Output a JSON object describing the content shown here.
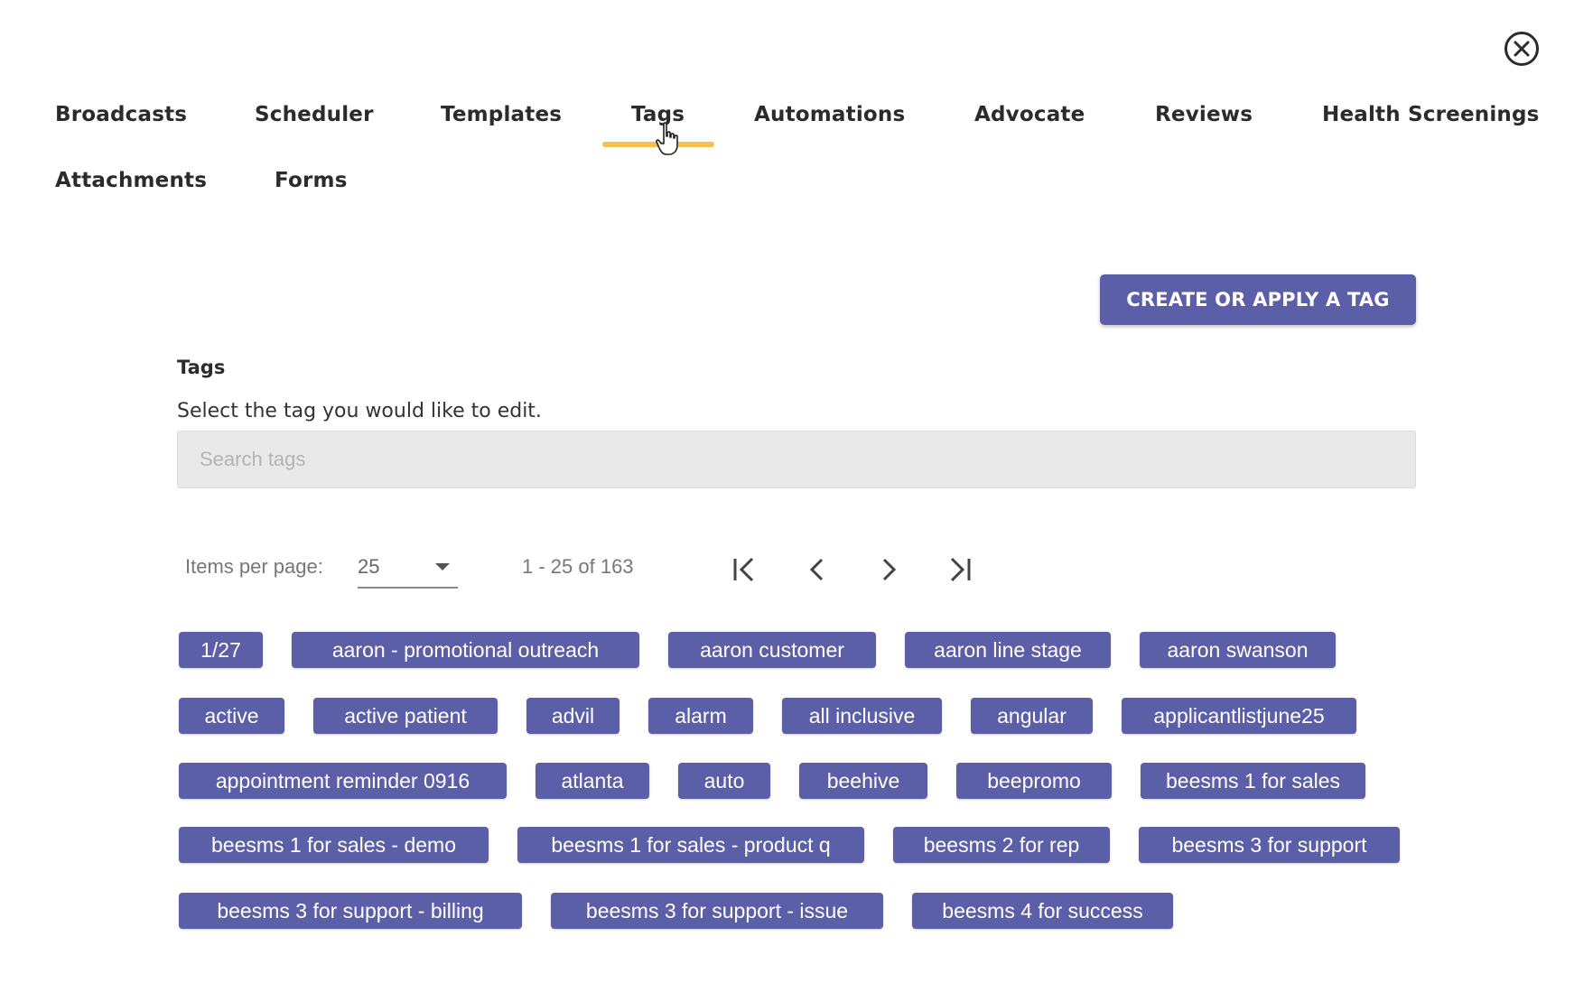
{
  "close": {
    "icon": "close-circle-icon"
  },
  "nav": {
    "tabs": [
      {
        "label": "Broadcasts"
      },
      {
        "label": "Scheduler"
      },
      {
        "label": "Templates"
      },
      {
        "label": "Tags"
      },
      {
        "label": "Automations"
      },
      {
        "label": "Advocate"
      },
      {
        "label": "Reviews"
      },
      {
        "label": "Health Screenings"
      },
      {
        "label": "Attachments"
      },
      {
        "label": "Forms"
      }
    ],
    "active_tab": "Tags",
    "underline_color": "#f2c14e"
  },
  "actions": {
    "create_label": "CREATE OR APPLY A TAG"
  },
  "tags_section": {
    "title": "Tags",
    "description": "Select the tag you would like to edit.",
    "search_placeholder": "Search tags",
    "search_value": ""
  },
  "pagination": {
    "items_per_page_label": "Items per page:",
    "items_per_page": "25",
    "range": "1 - 25 of 163",
    "first_icon": "first-page-icon",
    "prev_icon": "chevron-left-icon",
    "next_icon": "chevron-right-icon",
    "last_icon": "last-page-icon"
  },
  "tags": [
    "1/27",
    "aaron - promotional outreach",
    "aaron customer",
    "aaron line stage",
    "aaron swanson",
    "active",
    "active patient",
    "advil",
    "alarm",
    "all inclusive",
    "angular",
    "applicantlistjune25",
    "appointment reminder 0916",
    "atlanta",
    "auto",
    "beehive",
    "beepromo",
    "beesms 1 for sales",
    "beesms 1 for sales - demo",
    "beesms 1 for sales - product q",
    "beesms 2 for rep",
    "beesms 3 for support",
    "beesms 3 for support - billing",
    "beesms 3 for support - issue",
    "beesms 4 for success"
  ],
  "colors": {
    "accent": "#5a5fa8",
    "tab_underline": "#f2c14e",
    "search_bg": "#e9e9e9"
  }
}
